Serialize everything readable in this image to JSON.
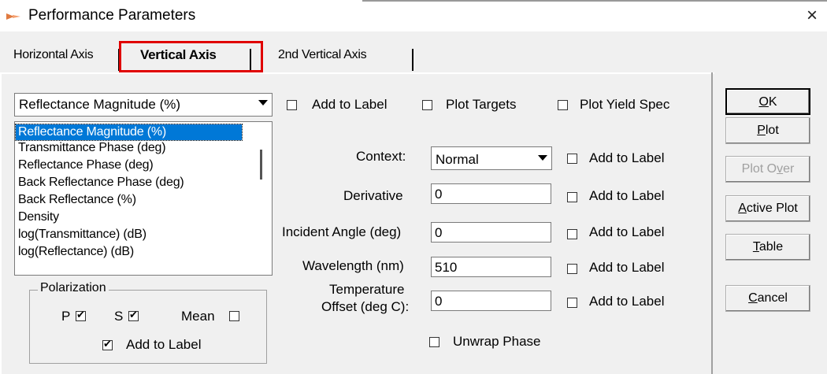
{
  "window": {
    "title": "Performance Parameters",
    "close": "×"
  },
  "tabs": [
    {
      "label": "Horizontal Axis"
    },
    {
      "label": "Vertical Axis"
    },
    {
      "label": "2nd Vertical Axis"
    }
  ],
  "vertical": {
    "quantity_selected": "Reflectance Magnitude (%)",
    "quantity_options": [
      "Reflectance Magnitude (%)",
      "Transmittance Phase (deg)",
      "Reflectance Phase  (deg)",
      "Back Reflectance Phase  (deg)",
      "Back Reflectance (%)",
      "Density",
      "log(Transmittance) (dB)",
      "log(Reflectance) (dB)"
    ],
    "top_checks": {
      "add_to_label": "Add to Label",
      "plot_targets": "Plot Targets",
      "plot_yield_spec": "Plot Yield Spec"
    },
    "fields": {
      "context_label": "Context:",
      "context_value": "Normal",
      "derivative_label": "Derivative",
      "derivative_value": "0",
      "incident_label": "Incident Angle (deg)",
      "incident_value": "0",
      "wavelength_label": "Wavelength (nm)",
      "wavelength_value": "510",
      "temperature_label_1": "Temperature",
      "temperature_label_2": "Offset (deg C):",
      "temperature_value": "0",
      "add_to_label": "Add to Label"
    },
    "unwrap_phase": "Unwrap Phase",
    "polarization": {
      "title": "Polarization",
      "p": "P",
      "s": "S",
      "mean": "Mean",
      "add_to_label": "Add to Label"
    }
  },
  "buttons": {
    "ok": "OK",
    "plot": "Plot",
    "plot_over": "Plot Over",
    "active_plot": "Active Plot",
    "table": "Table",
    "cancel": "Cancel"
  },
  "colors": {
    "highlight": "#e00000",
    "selection": "#0078d7"
  }
}
